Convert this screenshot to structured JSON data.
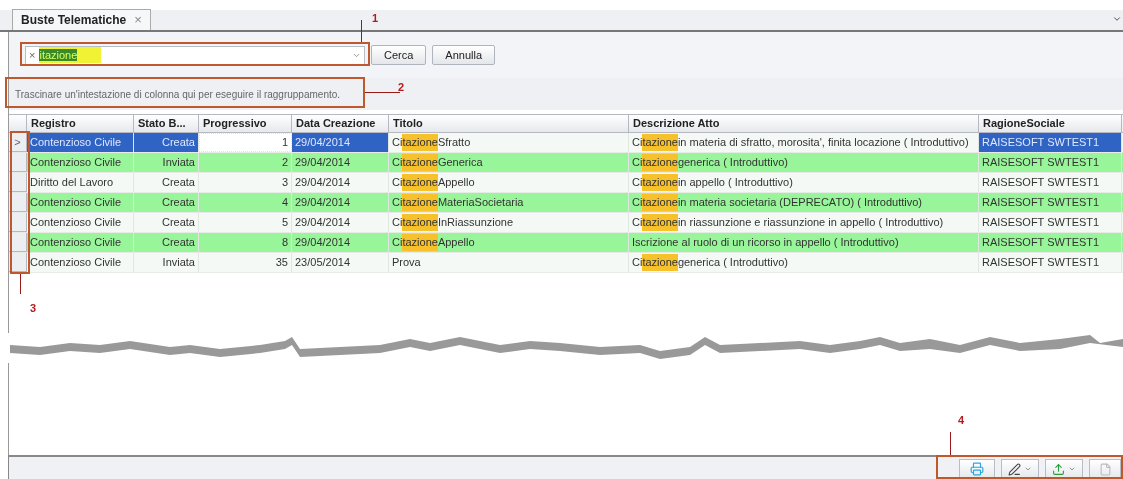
{
  "tab": {
    "title": "Buste Telematiche",
    "close": "×"
  },
  "search": {
    "clear": "×",
    "value": "itazione",
    "buttons": [
      "Cerca",
      "Annulla"
    ]
  },
  "group_panel": {
    "hint": "Trascinare un'intestazione di colonna qui per eseguire il raggruppamento."
  },
  "table": {
    "columns": [
      "Registro",
      "Stato B...",
      "Progressivo",
      "Data Creazione",
      "Titolo",
      "Descrizione Atto",
      "RagioneSociale"
    ],
    "rows": [
      {
        "selected": true,
        "highlighted": false,
        "indicator": ">",
        "registro": "Contenzioso Civile",
        "stato": "Creata",
        "progressivo": "1",
        "data": "29/04/2014",
        "titolo": [
          {
            "text": "Ci",
            "hl": false
          },
          {
            "text": "tazione",
            "hl": true
          },
          {
            "text": "Sfratto",
            "hl": false
          }
        ],
        "descrizione": [
          {
            "text": "Ci",
            "hl": false
          },
          {
            "text": "tazione",
            "hl": true
          },
          {
            "text": " in materia di sfratto, morosita', finita locazione ( Introduttivo)",
            "hl": false
          }
        ],
        "ragione": "RAISESOFT SWTEST1"
      },
      {
        "selected": false,
        "highlighted": true,
        "registro": "Contenzioso Civile",
        "stato": "Inviata",
        "progressivo": "2",
        "data": "29/04/2014",
        "titolo": [
          {
            "text": "Ci",
            "hl": false
          },
          {
            "text": "tazione",
            "hl": true
          },
          {
            "text": "Generica",
            "hl": false
          }
        ],
        "descrizione": [
          {
            "text": "Ci",
            "hl": false
          },
          {
            "text": "tazione",
            "hl": true
          },
          {
            "text": " generica ( Introduttivo)",
            "hl": false
          }
        ],
        "ragione": "RAISESOFT SWTEST1"
      },
      {
        "selected": false,
        "highlighted": false,
        "registro": "Diritto del Lavoro",
        "stato": "Creata",
        "progressivo": "3",
        "data": "29/04/2014",
        "titolo": [
          {
            "text": "Ci",
            "hl": false
          },
          {
            "text": "tazione",
            "hl": true
          },
          {
            "text": "Appello",
            "hl": false
          }
        ],
        "descrizione": [
          {
            "text": "Ci",
            "hl": false
          },
          {
            "text": "tazione",
            "hl": true
          },
          {
            "text": " in appello ( Introduttivo)",
            "hl": false
          }
        ],
        "ragione": "RAISESOFT SWTEST1"
      },
      {
        "selected": false,
        "highlighted": true,
        "registro": "Contenzioso Civile",
        "stato": "Creata",
        "progressivo": "4",
        "data": "29/04/2014",
        "titolo": [
          {
            "text": "Ci",
            "hl": false
          },
          {
            "text": "tazione",
            "hl": true
          },
          {
            "text": "MateriaSocietaria",
            "hl": false
          }
        ],
        "descrizione": [
          {
            "text": "Ci",
            "hl": false
          },
          {
            "text": "tazione",
            "hl": true
          },
          {
            "text": " in materia societaria (DEPRECATO) ( Introduttivo)",
            "hl": false
          }
        ],
        "ragione": "RAISESOFT SWTEST1"
      },
      {
        "selected": false,
        "highlighted": false,
        "registro": "Contenzioso Civile",
        "stato": "Creata",
        "progressivo": "5",
        "data": "29/04/2014",
        "titolo": [
          {
            "text": "Ci",
            "hl": false
          },
          {
            "text": "tazione",
            "hl": true
          },
          {
            "text": "InRiassunzione",
            "hl": false
          }
        ],
        "descrizione": [
          {
            "text": "Ci",
            "hl": false
          },
          {
            "text": "tazione",
            "hl": true
          },
          {
            "text": " in riassunzione e riassunzione in appello ( Introduttivo)",
            "hl": false
          }
        ],
        "ragione": "RAISESOFT SWTEST1"
      },
      {
        "selected": false,
        "highlighted": true,
        "registro": "Contenzioso Civile",
        "stato": "Creata",
        "progressivo": "8",
        "data": "29/04/2014",
        "titolo": [
          {
            "text": "Ci",
            "hl": false
          },
          {
            "text": "tazione",
            "hl": true
          },
          {
            "text": "Appello",
            "hl": false
          }
        ],
        "descrizione": [
          {
            "text": "Iscrizione al ruolo di un ricorso in appello ( Introduttivo)",
            "hl": false
          }
        ],
        "ragione": "RAISESOFT SWTEST1"
      },
      {
        "selected": false,
        "highlighted": false,
        "registro": "Contenzioso Civile",
        "stato": "Inviata",
        "progressivo": "35",
        "data": "23/05/2014",
        "titolo": [
          {
            "text": "Prova",
            "hl": false
          }
        ],
        "descrizione": [
          {
            "text": "Ci",
            "hl": false
          },
          {
            "text": "tazione",
            "hl": true
          },
          {
            "text": " generica ( Introduttivo)",
            "hl": false
          }
        ],
        "ragione": "RAISESOFT SWTEST1"
      }
    ]
  },
  "annotations": [
    {
      "label": "1"
    },
    {
      "label": "2"
    },
    {
      "label": "3"
    },
    {
      "label": "4"
    }
  ]
}
